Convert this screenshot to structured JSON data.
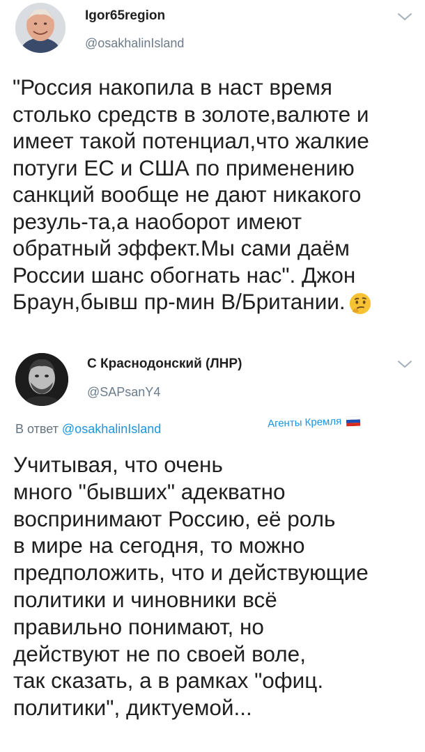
{
  "tweet1": {
    "author_name": "Igor65region",
    "author_handle": "@osakhalinIsland",
    "text_lines": [
      "\"Россия накопила в наст время",
      "столько средств в золоте,валюте и",
      "имеет такой потенциал,что жалкие",
      "потуги ЕС и США по применению",
      "санкций вообще не дают никакого",
      "резуль-та,а наоборот имеют",
      "обратный эффект.Мы сами даём",
      "России шанс обогнать нас\". Джон",
      "Браун,бывш пр-мин В/Британии."
    ],
    "emoji": "thinking-face"
  },
  "tweet2": {
    "author_name": "С Краснодонский (ЛНР)",
    "author_handle": "@SAPsanY4",
    "reply_prefix": "В ответ",
    "reply_handle": "@osakhalinIsland",
    "annotation": "Агенты Кремля",
    "annotation_icon": "russian-flag",
    "text_lines": [
      "Учитывая, что очень",
      "много \"бывших\" адекватно",
      "воспринимают Россию, её роль",
      "в мире на сегодня, то можно",
      "предположить, что и действующие",
      "политики и чиновники всё",
      "правильно понимают, но",
      "действуют не по своей воле,",
      "так сказать, а в рамках \"офиц.",
      "политики\", диктуемой..."
    ]
  },
  "colors": {
    "text": "#1f1f1f",
    "handle": "#6b7b89",
    "link": "#1b95e0",
    "flag_white": "#ffffff",
    "flag_blue": "#1e4fb3",
    "flag_red": "#d52b1e"
  }
}
